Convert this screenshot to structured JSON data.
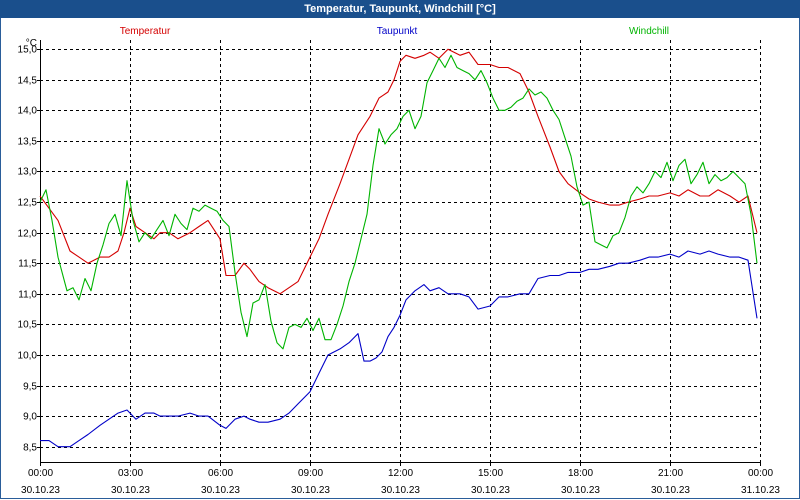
{
  "window": {
    "title": "Temperatur, Taupunkt, Windchill [°C]"
  },
  "chart_data": {
    "type": "line",
    "unit_label": "°C",
    "ylim": [
      8.25,
      15.15
    ],
    "y_ticks": [
      8.5,
      9.0,
      9.5,
      10.0,
      10.5,
      11.0,
      11.5,
      12.0,
      12.5,
      13.0,
      13.5,
      14.0,
      14.5,
      15.0
    ],
    "y_tick_labels": [
      "8,5",
      "9,0",
      "9,5",
      "10,0",
      "10,5",
      "11,0",
      "11,5",
      "12,0",
      "12,5",
      "13,0",
      "13,5",
      "14,0",
      "14,5",
      "15,0"
    ],
    "xlim": [
      0,
      24
    ],
    "x_ticks": [
      {
        "hour": 0,
        "time": "00:00",
        "date": "30.10.23"
      },
      {
        "hour": 3,
        "time": "03:00",
        "date": "30.10.23"
      },
      {
        "hour": 6,
        "time": "06:00",
        "date": "30.10.23"
      },
      {
        "hour": 9,
        "time": "09:00",
        "date": "30.10.23"
      },
      {
        "hour": 12,
        "time": "12:00",
        "date": "30.10.23"
      },
      {
        "hour": 15,
        "time": "15:00",
        "date": "30.10.23"
      },
      {
        "hour": 18,
        "time": "18:00",
        "date": "30.10.23"
      },
      {
        "hour": 21,
        "time": "21:00",
        "date": "30.10.23"
      },
      {
        "hour": 24,
        "time": "00:00",
        "date": "31.10.23"
      }
    ],
    "grid": true,
    "legend": "top",
    "series": [
      {
        "name": "Temperatur",
        "color": "#d40000",
        "x": [
          0,
          0.3,
          0.6,
          1,
          1.3,
          1.6,
          2,
          2.3,
          2.6,
          2.8,
          3,
          3.2,
          3.5,
          3.8,
          4,
          4.3,
          4.6,
          5,
          5.3,
          5.6,
          6,
          6.2,
          6.5,
          6.8,
          7,
          7.3,
          7.6,
          8,
          8.3,
          8.6,
          9,
          9.3,
          9.6,
          10,
          10.3,
          10.6,
          11,
          11.3,
          11.6,
          11.8,
          12,
          12.2,
          12.5,
          12.8,
          13,
          13.3,
          13.6,
          14,
          14.3,
          14.6,
          15,
          15.3,
          15.6,
          16,
          16.3,
          16.6,
          17,
          17.3,
          17.6,
          18,
          18.3,
          18.6,
          19,
          19.3,
          19.6,
          20,
          20.3,
          20.6,
          21,
          21.3,
          21.6,
          22,
          22.3,
          22.6,
          23,
          23.3,
          23.6,
          23.9
        ],
        "y": [
          12.6,
          12.4,
          12.2,
          11.7,
          11.6,
          11.5,
          11.6,
          11.6,
          11.7,
          12.0,
          12.4,
          12.1,
          12.0,
          11.9,
          12.0,
          12.0,
          11.9,
          12.0,
          12.1,
          12.2,
          11.9,
          11.3,
          11.3,
          11.5,
          11.4,
          11.2,
          11.1,
          11.0,
          11.1,
          11.2,
          11.6,
          11.9,
          12.3,
          12.8,
          13.2,
          13.6,
          13.9,
          14.2,
          14.3,
          14.5,
          14.8,
          14.9,
          14.85,
          14.9,
          14.95,
          14.85,
          15.0,
          14.9,
          14.95,
          14.75,
          14.75,
          14.7,
          14.7,
          14.6,
          14.3,
          13.9,
          13.4,
          13.0,
          12.8,
          12.65,
          12.55,
          12.5,
          12.45,
          12.45,
          12.5,
          12.55,
          12.6,
          12.6,
          12.65,
          12.6,
          12.7,
          12.6,
          12.6,
          12.7,
          12.6,
          12.5,
          12.6,
          12.0
        ]
      },
      {
        "name": "Taupunkt",
        "color": "#0000c8",
        "x": [
          0,
          0.3,
          0.6,
          1,
          1.3,
          1.6,
          2,
          2.3,
          2.6,
          2.9,
          3.2,
          3.5,
          3.8,
          4,
          4.3,
          4.6,
          5,
          5.3,
          5.6,
          6,
          6.2,
          6.5,
          6.8,
          7,
          7.3,
          7.6,
          8,
          8.3,
          8.6,
          9,
          9.3,
          9.6,
          10,
          10.3,
          10.6,
          10.8,
          11,
          11.2,
          11.4,
          11.6,
          11.8,
          12,
          12.2,
          12.5,
          12.8,
          13,
          13.3,
          13.6,
          14,
          14.3,
          14.6,
          15,
          15.3,
          15.6,
          16,
          16.3,
          16.6,
          17,
          17.3,
          17.6,
          18,
          18.3,
          18.6,
          19,
          19.3,
          19.6,
          20,
          20.3,
          20.6,
          21,
          21.3,
          21.6,
          22,
          22.3,
          22.6,
          23,
          23.3,
          23.6,
          23.9
        ],
        "y": [
          8.6,
          8.6,
          8.5,
          8.5,
          8.6,
          8.7,
          8.85,
          8.95,
          9.05,
          9.1,
          8.95,
          9.05,
          9.05,
          9.0,
          9.0,
          9.0,
          9.05,
          9.0,
          9.0,
          8.85,
          8.8,
          8.95,
          9.0,
          8.95,
          8.9,
          8.9,
          8.95,
          9.05,
          9.2,
          9.4,
          9.7,
          10.0,
          10.1,
          10.2,
          10.35,
          9.9,
          9.9,
          9.95,
          10.05,
          10.3,
          10.45,
          10.65,
          10.9,
          11.05,
          11.15,
          11.05,
          11.1,
          11.0,
          11.0,
          10.95,
          10.75,
          10.8,
          10.95,
          10.95,
          11.0,
          11.0,
          11.25,
          11.3,
          11.3,
          11.35,
          11.35,
          11.4,
          11.4,
          11.45,
          11.5,
          11.5,
          11.55,
          11.6,
          11.6,
          11.65,
          11.6,
          11.7,
          11.65,
          11.7,
          11.65,
          11.6,
          11.6,
          11.55,
          10.6
        ]
      },
      {
        "name": "Windchill",
        "color": "#00b400",
        "x": [
          0,
          0.2,
          0.4,
          0.6,
          0.9,
          1.1,
          1.3,
          1.5,
          1.7,
          1.9,
          2.1,
          2.3,
          2.5,
          2.7,
          2.9,
          3.1,
          3.3,
          3.5,
          3.7,
          3.9,
          4.1,
          4.3,
          4.5,
          4.7,
          4.9,
          5.1,
          5.3,
          5.5,
          5.7,
          5.9,
          6.1,
          6.3,
          6.5,
          6.7,
          6.9,
          7.1,
          7.3,
          7.5,
          7.7,
          7.9,
          8.1,
          8.3,
          8.5,
          8.7,
          8.9,
          9.1,
          9.3,
          9.5,
          9.7,
          9.9,
          10.1,
          10.3,
          10.5,
          10.7,
          10.9,
          11.1,
          11.3,
          11.5,
          11.7,
          11.9,
          12.1,
          12.3,
          12.5,
          12.7,
          12.9,
          13.1,
          13.3,
          13.5,
          13.7,
          13.9,
          14.1,
          14.3,
          14.5,
          14.7,
          14.9,
          15.1,
          15.3,
          15.5,
          15.7,
          15.9,
          16.1,
          16.3,
          16.5,
          16.7,
          16.9,
          17.1,
          17.3,
          17.5,
          17.7,
          17.9,
          18.1,
          18.3,
          18.5,
          18.7,
          18.9,
          19.1,
          19.3,
          19.5,
          19.7,
          19.9,
          20.1,
          20.3,
          20.5,
          20.7,
          20.9,
          21.1,
          21.3,
          21.5,
          21.7,
          21.9,
          22.1,
          22.3,
          22.5,
          22.7,
          22.9,
          23.1,
          23.3,
          23.5,
          23.7,
          23.9
        ],
        "y": [
          12.5,
          12.7,
          12.2,
          11.6,
          11.05,
          11.1,
          10.9,
          11.25,
          11.05,
          11.5,
          11.8,
          12.15,
          12.3,
          11.95,
          12.85,
          12.2,
          11.85,
          12.0,
          11.9,
          12.05,
          12.2,
          11.95,
          12.3,
          12.15,
          12.05,
          12.4,
          12.35,
          12.45,
          12.4,
          12.35,
          12.2,
          12.1,
          11.35,
          10.7,
          10.3,
          10.85,
          10.9,
          11.15,
          10.55,
          10.2,
          10.1,
          10.45,
          10.5,
          10.45,
          10.6,
          10.4,
          10.6,
          10.25,
          10.25,
          10.5,
          10.8,
          11.2,
          11.5,
          11.9,
          12.3,
          13.1,
          13.7,
          13.45,
          13.6,
          13.7,
          13.9,
          14.0,
          13.7,
          13.9,
          14.45,
          14.65,
          14.85,
          14.7,
          14.9,
          14.7,
          14.65,
          14.6,
          14.5,
          14.65,
          14.45,
          14.2,
          14.0,
          14.0,
          14.05,
          14.15,
          14.2,
          14.35,
          14.25,
          14.3,
          14.2,
          14.0,
          13.85,
          13.55,
          13.25,
          12.75,
          12.45,
          12.5,
          11.85,
          11.8,
          11.75,
          11.95,
          12.0,
          12.25,
          12.6,
          12.75,
          12.65,
          12.8,
          13.0,
          12.9,
          13.15,
          12.85,
          13.1,
          13.2,
          12.8,
          12.95,
          13.15,
          12.8,
          12.95,
          12.85,
          12.9,
          13.0,
          12.9,
          12.8,
          12.3,
          11.5
        ]
      }
    ]
  }
}
